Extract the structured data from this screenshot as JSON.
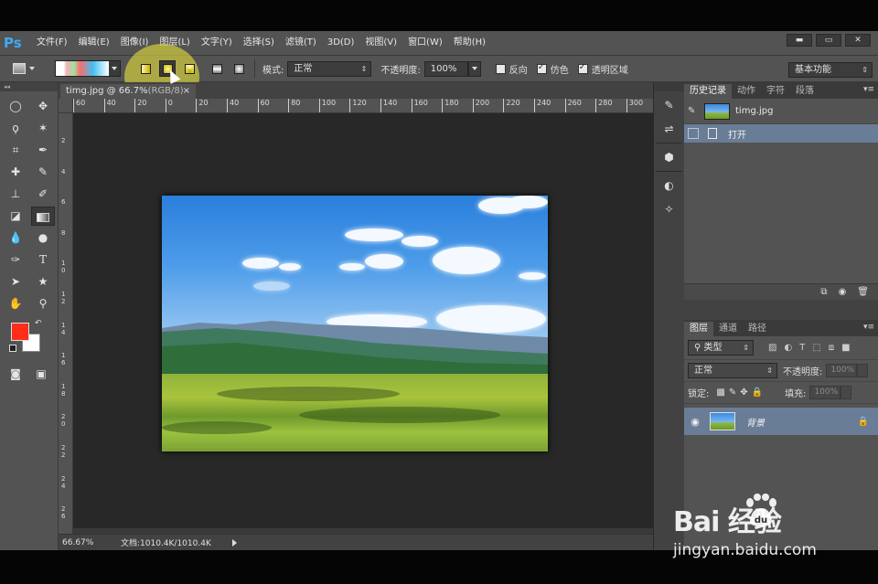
{
  "app": {
    "logo": "Ps"
  },
  "menu": [
    "文件(F)",
    "编辑(E)",
    "图像(I)",
    "图层(L)",
    "文字(Y)",
    "选择(S)",
    "滤镜(T)",
    "3D(D)",
    "视图(V)",
    "窗口(W)",
    "帮助(H)"
  ],
  "window_buttons": [
    "▬",
    "▭",
    "✕"
  ],
  "options": {
    "mode_label": "模式:",
    "mode_value": "正常",
    "opacity_label": "不透明度:",
    "opacity_value": "100%",
    "reverse_label": "反向",
    "dither_label": "仿色",
    "transparency_label": "透明区域",
    "workspace": "基本功能",
    "reverse_checked": false,
    "dither_checked": true,
    "transparency_checked": true
  },
  "document": {
    "tab_title": "timg.jpg @ 66.7%",
    "tab_mode": "(RGB/8)",
    "close": "×"
  },
  "ruler": {
    "h_ticks": [
      "60",
      "40",
      "20",
      "0",
      "20",
      "40",
      "60",
      "80",
      "100",
      "120",
      "140",
      "160",
      "180",
      "200",
      "220",
      "240",
      "260",
      "280",
      "300"
    ],
    "v_ticks": [
      "2",
      "4",
      "6",
      "8",
      "1 0",
      "1 2",
      "1 4",
      "1 6",
      "1 8",
      "2 0",
      "2 2",
      "2 4",
      "2 6",
      "2 8",
      "3 0"
    ]
  },
  "status": {
    "zoom": "66.67%",
    "doc_info": "文档:1010.4K/1010.4K"
  },
  "history_panel": {
    "tabs": [
      "历史记录",
      "动作",
      "字符",
      "段落"
    ],
    "snapshot_name": "timg.jpg",
    "step_label": "打开"
  },
  "layers_panel": {
    "tabs": [
      "图层",
      "通道",
      "路径"
    ],
    "filter_label": "类型",
    "blend_mode": "正常",
    "opacity_label": "不透明度:",
    "opacity_value": "100%",
    "lock_label": "锁定:",
    "fill_label": "填充:",
    "fill_value": "100%",
    "layer_name": "背景"
  },
  "watermark": {
    "brand": "Bai  经验",
    "url": "jingyan.baidu.com"
  }
}
